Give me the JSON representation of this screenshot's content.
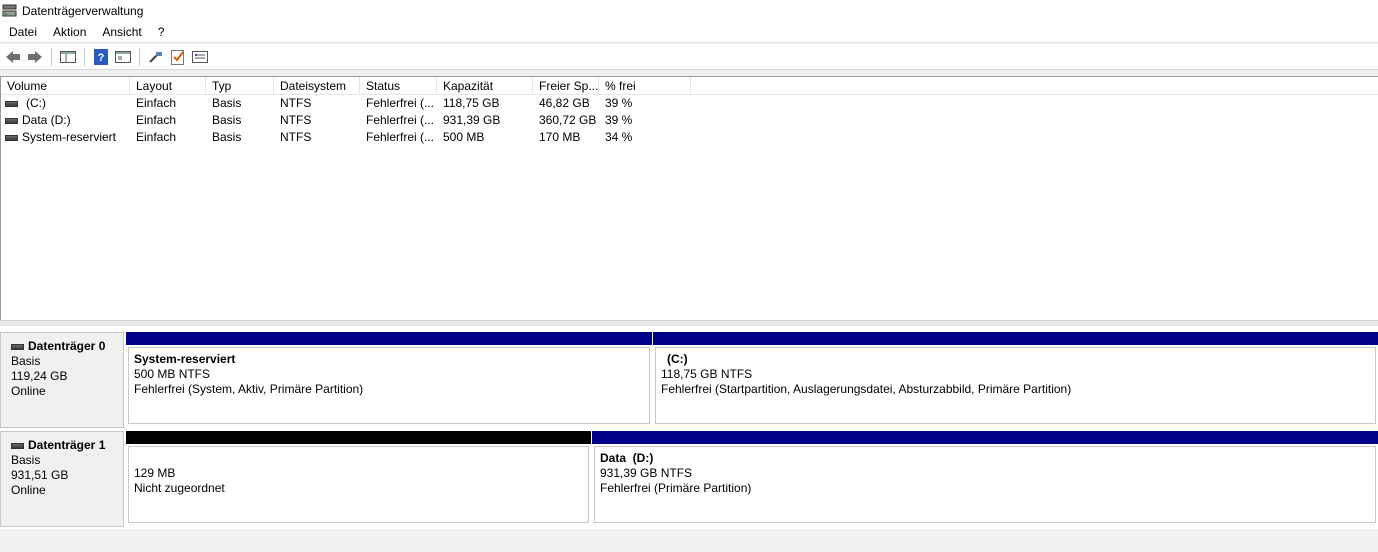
{
  "window": {
    "title": "Datenträgerverwaltung"
  },
  "menu": [
    "Datei",
    "Aktion",
    "Ansicht",
    "?"
  ],
  "toolbar": {
    "buttons": [
      "back-icon",
      "forward-icon",
      "console-tree-icon",
      "help-icon",
      "properties-icon",
      "connect-icon",
      "check-icon",
      "settings-icon"
    ]
  },
  "list": {
    "columns": [
      "Volume",
      "Layout",
      "Typ",
      "Dateisystem",
      "Status",
      "Kapazität",
      "Freier Sp...",
      "% frei"
    ],
    "rows": [
      [
        "(C:)",
        "Einfach",
        "Basis",
        "NTFS",
        "Fehlerfrei (...",
        "118,75 GB",
        "46,82 GB",
        "39 %"
      ],
      [
        "Data (D:)",
        "Einfach",
        "Basis",
        "NTFS",
        "Fehlerfrei (...",
        "931,39 GB",
        "360,72 GB",
        "39 %"
      ],
      [
        "System-reserviert",
        "Einfach",
        "Basis",
        "NTFS",
        "Fehlerfrei (...",
        "500 MB",
        "170 MB",
        "34 %"
      ]
    ]
  },
  "disks": [
    {
      "name": "Datenträger 0",
      "type": "Basis",
      "size": "119,24 GB",
      "state": "Online",
      "partitions": [
        {
          "name": "System-reserviert",
          "size": "500 MB NTFS",
          "status": "Fehlerfrei (System, Aktiv, Primäre Partition)"
        },
        {
          "name": "(C:)",
          "size": "118,75 GB NTFS",
          "status": "Fehlerfrei (Startpartition, Auslagerungsdatei, Absturzabbild, Primäre Partition)"
        }
      ]
    },
    {
      "name": "Datenträger 1",
      "type": "Basis",
      "size": "931,51 GB",
      "state": "Online",
      "partitions": [
        {
          "name": "",
          "size": "129 MB",
          "status": "Nicht zugeordnet"
        },
        {
          "name": "Data  (D:)",
          "size": "931,39 GB NTFS",
          "status": "Fehlerfrei (Primäre Partition)"
        }
      ]
    }
  ],
  "colors": {
    "primary_partition": "#00008b",
    "unallocated": "#000000"
  }
}
